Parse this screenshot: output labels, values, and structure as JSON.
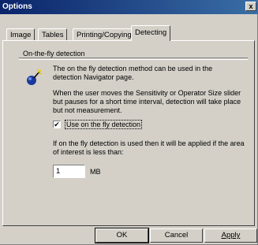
{
  "window": {
    "title": "Options",
    "close_glyph": "x"
  },
  "tabs": [
    {
      "label": "Image",
      "active": false
    },
    {
      "label": "Tables",
      "active": false
    },
    {
      "label": "Printing/Copying",
      "active": false
    },
    {
      "label": "Detecting",
      "active": true
    }
  ],
  "group": {
    "label": "On-the-fly detection",
    "icon": "detection-wand-icon",
    "description": [
      "The on the fly detection method can be used in the",
      "detection Navigator page."
    ],
    "details": [
      "When the user moves the Sensitivity or Operator Size slider",
      "but pauses for a short time interval, detection will take place",
      "but not measurement."
    ],
    "checkbox": {
      "label": "Use on the fly detection",
      "checked": true,
      "mark": "✔"
    },
    "threshold_text": [
      "If on the fly detection is used then it will be applied if the area",
      "of interest is less than:"
    ],
    "threshold": {
      "value": "1",
      "unit": "MB"
    }
  },
  "buttons": {
    "ok": "OK",
    "cancel": "Cancel",
    "apply": "Apply"
  },
  "colors": {
    "face": "#d4d0c8",
    "title_start": "#0a246a",
    "title_end": "#3a6ea5"
  }
}
